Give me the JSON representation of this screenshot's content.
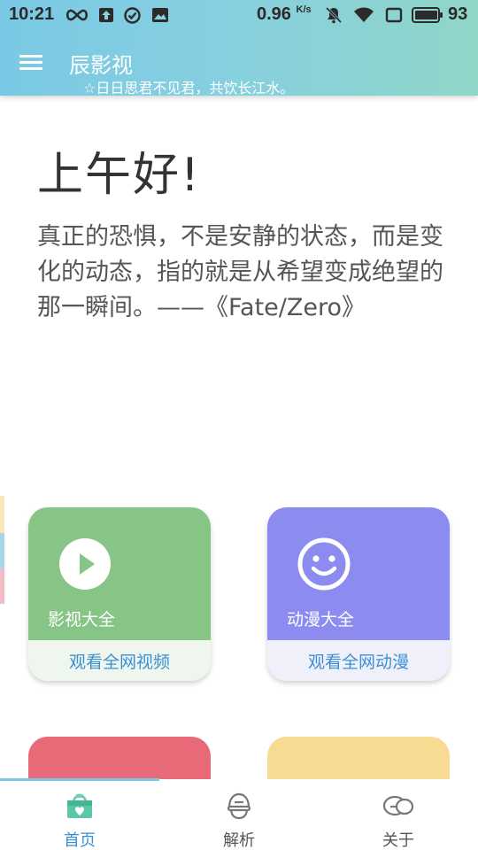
{
  "status_bar": {
    "time": "10:21",
    "net_speed": "0.96",
    "net_speed_unit": "K/s",
    "battery": "93",
    "icons": [
      "infinity-icon",
      "upload-icon",
      "check-circle-icon",
      "image-icon",
      "bell-off-icon",
      "wifi-icon",
      "sim-icon",
      "battery-icon"
    ]
  },
  "app_bar": {
    "title": "辰影视",
    "subtitle": "☆日日思君不见君，共饮长江水。"
  },
  "main": {
    "greeting": "上午好!",
    "quote": "真正的恐惧，不是安静的状态，而是变化的动态，指的就是从希望变成绝望的那一瞬间。——《Fate/Zero》"
  },
  "cards": [
    {
      "label": "影视大全",
      "action": "观看全网视频",
      "icon": "play-icon",
      "color": "#86c585"
    },
    {
      "label": "动漫大全",
      "action": "观看全网动漫",
      "icon": "smile-icon",
      "color": "#8b8bf0"
    }
  ],
  "partial_cards": [
    {
      "color": "#e86a79"
    },
    {
      "color": "#f8db92"
    }
  ],
  "bottom_nav": {
    "items": [
      {
        "label": "首页",
        "icon": "home-box-icon",
        "active": true
      },
      {
        "label": "解析",
        "icon": "helmet-icon",
        "active": false
      },
      {
        "label": "关于",
        "icon": "chat-bubbles-icon",
        "active": false
      }
    ]
  },
  "colors": {
    "accent": "#3a8fd6",
    "header_start": "#79c9e4",
    "header_end": "#8fd6c8"
  }
}
